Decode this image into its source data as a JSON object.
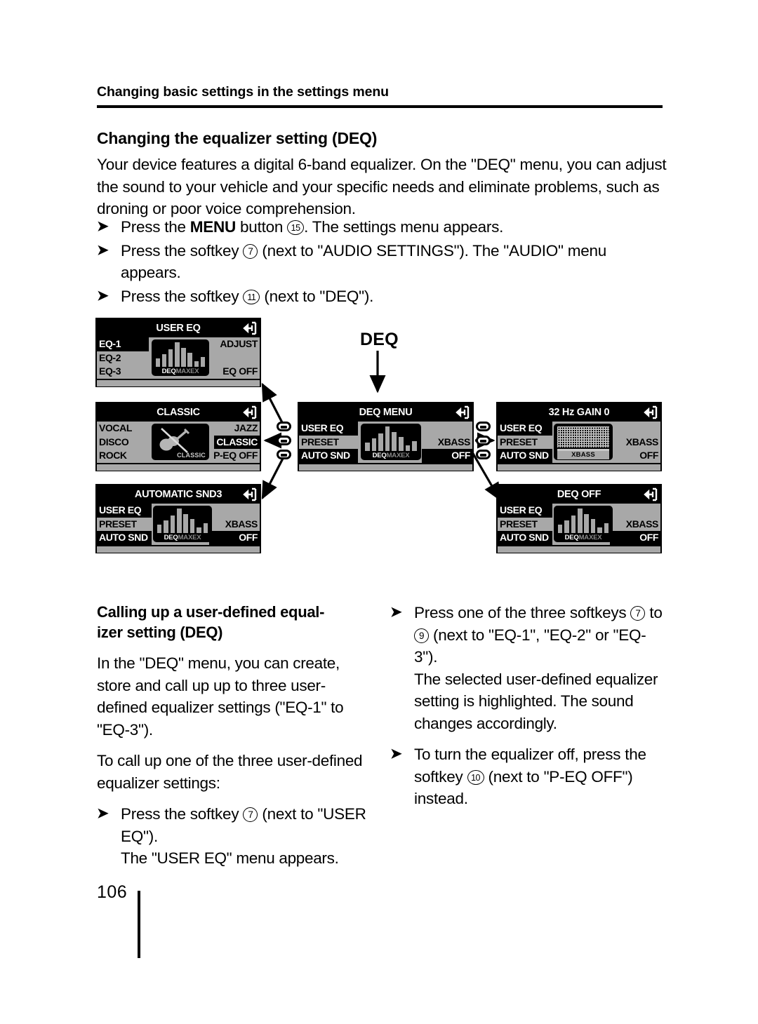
{
  "running_head": "Changing basic settings in the settings menu",
  "section": {
    "heading": "Changing the equalizer setting (DEQ)",
    "intro": "Your device features a digital 6-band equalizer. On the \"DEQ\" menu, you can adjust the sound to your vehicle and your specific needs and eliminate problems, such as droning or poor voice comprehension."
  },
  "steps": [
    {
      "pre": "Press the ",
      "bold": "MENU",
      "mid": " button ",
      "key": "15",
      "post": ". The settings menu appears."
    },
    {
      "pre": "Press the softkey ",
      "key": "7",
      "post": " (next to \"AUDIO SETTINGS\"). The \"AUDIO\" menu appears."
    },
    {
      "pre": "Press the softkey ",
      "key": "11",
      "post": " (next to \"DEQ\")."
    }
  ],
  "diagram": {
    "label": "DEQ",
    "panels": {
      "user_eq": {
        "title": "USER EQ",
        "left": [
          "EQ-1",
          "EQ-2",
          "EQ-3"
        ],
        "left_highlight": 0,
        "right": [
          "ADJUST",
          "",
          "EQ OFF"
        ],
        "right_highlight": -1,
        "graphic": "eq-bars",
        "caption": {
          "a": "DEQ",
          "b": "MAX",
          "c": "EX"
        }
      },
      "classic": {
        "title": "CLASSIC",
        "left": [
          "VOCAL",
          "DISCO",
          "ROCK"
        ],
        "left_highlight": -1,
        "right": [
          "JAZZ",
          "CLASSIC",
          "P-EQ OFF"
        ],
        "right_highlight": 1,
        "graphic": "guitar-crossed",
        "caption_text": "CLASSIC"
      },
      "deq_menu": {
        "title": "DEQ MENU",
        "left": [
          "USER EQ",
          "PRESET",
          "AUTO SND"
        ],
        "left_highlight": 0,
        "right": [
          "",
          "XBASS",
          "OFF"
        ],
        "right_highlight": 2,
        "graphic": "eq-bars",
        "caption": {
          "a": "DEQ",
          "b": "MAX",
          "c": "EX"
        }
      },
      "gain": {
        "title": "32 Hz GAIN 0",
        "left": [
          "USER EQ",
          "PRESET",
          "AUTO SND"
        ],
        "left_highlight": 0,
        "right": [
          "",
          "XBASS",
          "OFF"
        ],
        "right_highlight": -1,
        "graphic": "xbass-grid",
        "caption_text": "XBASS"
      },
      "auto_snd": {
        "title": "AUTOMATIC SND3",
        "left": [
          "USER EQ",
          "PRESET",
          "AUTO SND"
        ],
        "left_highlight": 0,
        "right": [
          "",
          "XBASS",
          "OFF"
        ],
        "right_highlight": 2,
        "graphic": "eq-bars",
        "caption": {
          "a": "DEQ",
          "b": "MAX",
          "c": "EX"
        }
      },
      "deq_off": {
        "title": "DEQ OFF",
        "left": [
          "USER EQ",
          "PRESET",
          "AUTO SND"
        ],
        "left_highlight": 0,
        "right": [
          "",
          "XBASS",
          "OFF"
        ],
        "right_highlight": 2,
        "graphic": "eq-bars",
        "caption": {
          "a": "DEQ",
          "b": "MAX",
          "c": "EX"
        }
      }
    },
    "eq_bar_heights": [
      34,
      52,
      72,
      100,
      76,
      58,
      22,
      40
    ]
  },
  "left_column": {
    "heading": "Calling up a user-defined equal-\nizer setting (DEQ)",
    "p1": "In the \"DEQ\" menu, you can create, store and call up up to three user-defined equalizer settings (\"EQ-1\" to \"EQ-3\").",
    "p2": "To call up one of the three user-defined equalizer settings:",
    "step": {
      "pre": "Press the softkey ",
      "key": "7",
      "post": " (next to \"USER EQ\")."
    },
    "p3": "The \"USER EQ\" menu appears."
  },
  "right_column": {
    "step1": {
      "pre": "Press one of the three softkeys ",
      "key_a": "7",
      "mid": " to ",
      "key_b": "9",
      "post": " (next to \"EQ-1\", \"EQ-2\" or \"EQ-3\")."
    },
    "p1": "The selected user-defined equalizer setting is highlighted. The sound changes accordingly.",
    "step2": {
      "pre": "To turn the equalizer off, press the softkey ",
      "key": "10",
      "post": " (next to \"P-EQ OFF\") instead."
    }
  },
  "folio": "106",
  "colors": {
    "ink": "#000000",
    "panel_bg": "#a8a8a8",
    "panel_title_bg": "#000000",
    "bar_gray": "#a8a8a8"
  }
}
